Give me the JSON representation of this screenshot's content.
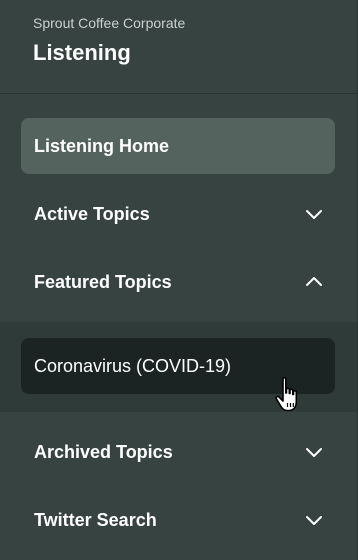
{
  "header": {
    "org_name": "Sprout Coffee Corporate",
    "title": "Listening"
  },
  "nav": {
    "home_label": "Listening Home",
    "active_topics_label": "Active Topics",
    "featured_topics_label": "Featured Topics",
    "featured_items": [
      "Coronavirus (COVID-19)"
    ],
    "archived_topics_label": "Archived Topics",
    "twitter_search_label": "Twitter Search"
  },
  "icons": {
    "chevron_down": "chevron-down-icon",
    "chevron_up": "chevron-up-icon",
    "cursor": "hand-pointer-icon"
  },
  "colors": {
    "panel_bg": "#364341",
    "active_item_bg": "#55635f",
    "sub_section_bg": "#2f3b39",
    "sub_item_bg": "#1b2422",
    "text": "#ffffff"
  }
}
